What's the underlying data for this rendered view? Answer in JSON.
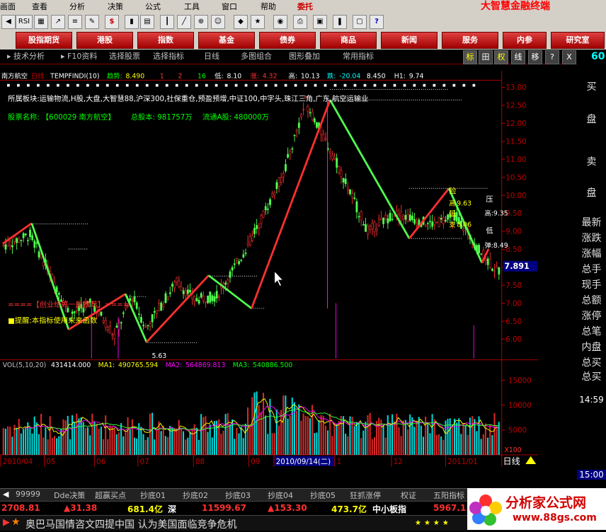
{
  "menubar": {
    "items": [
      "画面",
      "查看",
      "分析",
      "决策",
      "公式",
      "工具",
      "窗口",
      "帮助",
      "委托"
    ],
    "brand": "大智慧金融终端"
  },
  "toolbar1": {
    "icons": [
      "RSI",
      "$",
      "?"
    ]
  },
  "navbar": {
    "buttons": [
      "股指期货",
      "港股",
      "指数",
      "基金",
      "债券",
      "商品",
      "新闻",
      "服务",
      "内参",
      "研究室"
    ]
  },
  "toolbar2": {
    "items": [
      "技术分析",
      "F10资料",
      "选择股票",
      "选择指标",
      "日线",
      "多图组合",
      "图形叠加",
      "常用指标"
    ],
    "right_buttons": [
      "标",
      "田",
      "权",
      "线",
      "移",
      "?",
      "X"
    ],
    "code_fragment": "60"
  },
  "info_line": {
    "stock": "南方航空",
    "period": "日线",
    "indicator": "TEMPFINDI(10)",
    "mid_label": "趋势:",
    "mid_value": "8.490",
    "v1": "1",
    "v2": "2",
    "v3": "16",
    "low_label": "低:",
    "low_value": "8.10",
    "rise_label": "涨:",
    "rise_value": "4.32",
    "high_label": "高:",
    "high_value": "10.13",
    "fall_label": "跌:",
    "fall_value": "-20.04",
    "h_value": "8.450",
    "h1_label": "H1:",
    "h1_value": "9.74"
  },
  "overlay": {
    "sector": "所属板块:运输物流,H股,大盘,大智慧88,沪深300,社保重仓,预盈预增,中证100,中字头,珠江三角,广东,航空运输业",
    "stock_name_label": "股票名称:",
    "stock_name": "【600029 南方航空】",
    "total_shares_label": "总股本:",
    "total_shares": "981757万",
    "float_shares_label": "流通A股:",
    "float_shares": "480000万",
    "warning1": "====【创业给好一星推荐】====",
    "warning2": "■提醒:本指标使用未来函数"
  },
  "price_annotations": {
    "resist_label": "压",
    "high_label": "高:",
    "high_value": "9.35",
    "low_label": "低",
    "support_label": "弹:",
    "support_value": "8.49",
    "danger_label": "险",
    "peak_label": "高",
    "peak_value": "9.63",
    "low2_label": "低",
    "support2_label": "支",
    "support2_value": "8.06",
    "bottom_low": "5.63",
    "current_price": "7.891"
  },
  "price_axis": [
    "13.00",
    "12.50",
    "12.00",
    "11.50",
    "11.00",
    "10.50",
    "10.00",
    "9.50",
    "9.00",
    "8.50",
    "8.00",
    "7.50",
    "7.00",
    "6.50",
    "6.00"
  ],
  "volume_line": {
    "label": "VOL(5,10,20)",
    "vol": "431414.000",
    "ma1_label": "MA1:",
    "ma1": "490765.594",
    "ma2_label": "MA2:",
    "ma2": "564869.813",
    "ma3_label": "MA3:",
    "ma3": "540886.500"
  },
  "volume_axis": [
    "15000",
    "10000",
    "5000"
  ],
  "volume_unit": "X100",
  "date_axis": [
    "2010/04",
    "05",
    "06",
    "07",
    "08",
    "09",
    "2010/09/14(二)",
    "1",
    "12",
    "2011/01"
  ],
  "period_indicator": "日线",
  "right_panel": {
    "items": [
      "买",
      "盘",
      "卖",
      "盘",
      "最新",
      "涨跌",
      "涨幅",
      "总手",
      "现手",
      "总额",
      "涨停",
      "总笔",
      "内盘",
      "总买",
      "总买"
    ],
    "time": "14:59",
    "time2": "15:00"
  },
  "tabs": [
    "99999",
    "Dde决策",
    "超赢买点",
    "抄底01",
    "抄底02",
    "抄底03",
    "抄底04",
    "抄底05",
    "狂抓涨停",
    "权证",
    "五阳指标"
  ],
  "stockbar": {
    "index1": "2708.81",
    "change1": "31.38",
    "amount1": "681.4亿",
    "market2": "深",
    "index2": "11599.67",
    "change2": "153.30",
    "amount2": "473.7亿",
    "market3": "中小板指",
    "index3": "5967.1"
  },
  "news": "奥巴马国情咨文四提中国 认为美国面临竞争危机",
  "logo": {
    "text": "分析家公式网",
    "url": "www.88gs.com"
  },
  "chart_data": {
    "type": "candlestick",
    "ylim": [
      5.5,
      13.2
    ],
    "volume_ylim": [
      0,
      17000
    ]
  },
  "colors": {
    "up": "#ff3030",
    "down": "#50ff50",
    "axis": "#c00000",
    "yellow": "#ffff00",
    "magenta": "#ff00ff",
    "cyan": "#00ffff"
  }
}
